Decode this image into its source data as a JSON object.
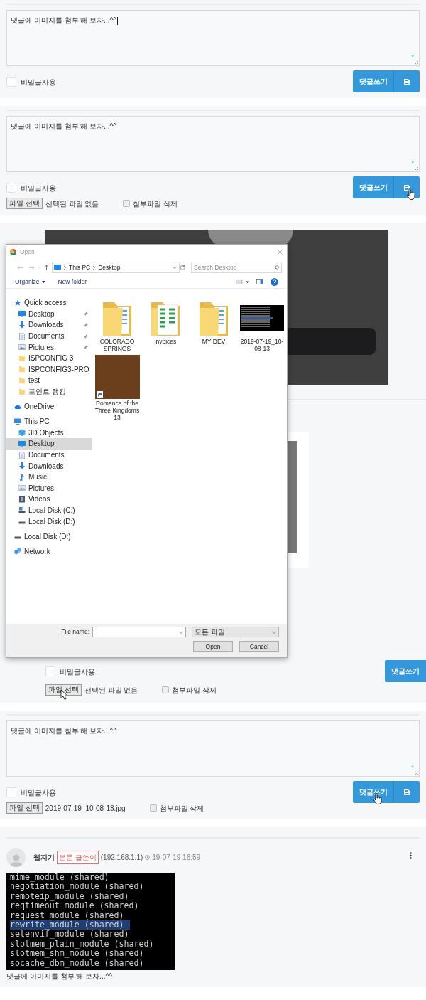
{
  "sections": [
    {
      "kind": "comment_form",
      "text": "댓글에 이미지를 첨부 해 보자...^^",
      "caret": true,
      "required_mark": "*",
      "secret_label": "비밀글사용",
      "secret_checked": false,
      "buttons": [
        {
          "kind": "submit",
          "label": "댓글쓰기"
        },
        {
          "kind": "save"
        }
      ]
    },
    {
      "kind": "comment_form",
      "text": "댓글에 이미지를 첨부 해 보자...^^",
      "caret": false,
      "required_mark": "*",
      "secret_label": "비밀글사용",
      "secret_checked": false,
      "buttons": [
        {
          "kind": "submit",
          "label": "댓글쓰기"
        },
        {
          "kind": "save",
          "hand_cursor": true
        }
      ],
      "file": {
        "button": "파일 선택",
        "status": "선택된 파일 없음",
        "delete_label": "첨부파일 삭제",
        "delete_checked": false
      }
    },
    {
      "kind": "file_dialog_frame",
      "dialog": {
        "title": "Open",
        "path": [
          "This PC",
          "Desktop"
        ],
        "search_placeholder": "Search Desktop",
        "toolbar": [
          "Organize",
          "New folder"
        ],
        "nav": [
          {
            "label": "Quick access",
            "kind": "star",
            "selected": false,
            "children": [
              {
                "label": "Desktop",
                "kind": "desktop",
                "pinned": true,
                "selected": false
              },
              {
                "label": "Downloads",
                "kind": "download",
                "pinned": true,
                "selected": false
              },
              {
                "label": "Documents",
                "kind": "document",
                "pinned": true,
                "selected": false
              },
              {
                "label": "Pictures",
                "kind": "pictures",
                "pinned": true,
                "selected": false
              },
              {
                "label": "ISPCONFIG 3",
                "kind": "folder",
                "pinned": false,
                "selected": false
              },
              {
                "label": "ISPCONFIG3-PRO",
                "kind": "folder",
                "pinned": false,
                "selected": false
              },
              {
                "label": "test",
                "kind": "folder",
                "pinned": false,
                "selected": false
              },
              {
                "label": "포인트 랭킹",
                "kind": "folder",
                "pinned": false,
                "selected": false
              }
            ]
          },
          {
            "label": "OneDrive",
            "kind": "cloud",
            "selected": false
          },
          {
            "label": "This PC",
            "kind": "pc",
            "selected": false,
            "children": [
              {
                "label": "3D Objects",
                "kind": "cube",
                "selected": false
              },
              {
                "label": "Desktop",
                "kind": "desktop",
                "selected": true
              },
              {
                "label": "Documents",
                "kind": "document",
                "selected": false
              },
              {
                "label": "Downloads",
                "kind": "download",
                "selected": false
              },
              {
                "label": "Music",
                "kind": "music",
                "selected": false
              },
              {
                "label": "Pictures",
                "kind": "pictures",
                "selected": false
              },
              {
                "label": "Videos",
                "kind": "video",
                "selected": false
              },
              {
                "label": "Local Disk (C:)",
                "kind": "system_disk",
                "selected": false
              },
              {
                "label": "Local Disk (D:)",
                "kind": "disk",
                "selected": false
              }
            ]
          },
          {
            "label": "Local Disk (D:)",
            "kind": "disk",
            "selected": false
          },
          {
            "label": "Network",
            "kind": "network",
            "selected": false
          }
        ],
        "files": [
          {
            "label": "COLORADO SPRINGS",
            "kind": "folder"
          },
          {
            "label": "invoices",
            "kind": "folder_sheets"
          },
          {
            "label": "MY DEV",
            "kind": "folder"
          },
          {
            "label": "2019-07-19_10-08-13",
            "kind": "screenshot"
          },
          {
            "label": "Romance of the Three Kingdoms 13",
            "kind": "shortcut_photo"
          }
        ],
        "file_name_label": "File name:",
        "file_type": "모든 파일",
        "buttons": [
          "Open",
          "Cancel"
        ]
      },
      "form": {
        "secret_label": "비밀글사용",
        "secret_checked": false,
        "buttons": [
          {
            "kind": "submit",
            "label": "댓글쓰기"
          }
        ],
        "file": {
          "button": "파일 선택",
          "status": "선택된 파일 없음",
          "delete_label": "첨부파일 삭제",
          "delete_checked": false,
          "arrow_cursor": true
        }
      }
    },
    {
      "kind": "comment_form",
      "text": "댓글에 이미지를 첨부 해 보자...^^",
      "caret": false,
      "required_mark": "*",
      "secret_label": "비밀글사용",
      "secret_checked": false,
      "buttons": [
        {
          "kind": "submit",
          "label": "댓글쓰기",
          "hand_cursor": true
        },
        {
          "kind": "save"
        }
      ],
      "file": {
        "button": "파일 선택",
        "status": "2019-07-19_10-08-13.jpg",
        "delete_label": "첨부파일 삭제",
        "delete_checked": false
      }
    },
    {
      "kind": "comment",
      "author": "웹지기",
      "badge": "본문 글쓴이",
      "ip": "(192.168.1.1)",
      "time": "19-07-19 16:59",
      "terminal": [
        {
          "text": "mime_module (shared)",
          "highlighted": false
        },
        {
          "text": "negotiation_module (shared)",
          "highlighted": false
        },
        {
          "text": "remoteip_module (shared)",
          "highlighted": false
        },
        {
          "text": "reqtimeout_module (shared)",
          "highlighted": false
        },
        {
          "text": "request_module (shared)",
          "highlighted": false
        },
        {
          "text": "rewrite_module (shared)",
          "highlighted": true
        },
        {
          "text": "setenvif_module (shared)",
          "highlighted": false
        },
        {
          "text": "slotmem_plain_module (shared)",
          "highlighted": false
        },
        {
          "text": "slotmem_shm_module (shared)",
          "highlighted": false
        },
        {
          "text": "socache_dbm_module (shared)",
          "highlighted": false
        }
      ],
      "text": "댓글에 이미지를 첨부 해 보자...^^"
    }
  ]
}
